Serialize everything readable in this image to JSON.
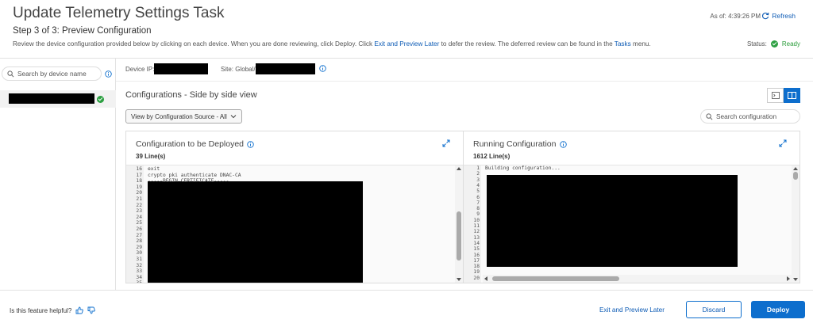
{
  "header": {
    "title": "Update Telemetry Settings Task",
    "step": "Step 3 of 3: Preview Configuration",
    "desc_part1": "Review the device configuration provided below by clicking on each device. When you are done reviewing, click Deploy. Click ",
    "desc_link1": "Exit and Preview Later",
    "desc_part2": " to defer the review. The deferred review can be found in the ",
    "desc_link2": "Tasks",
    "desc_part3": " menu.",
    "as_of": "As of: 4:39:26 PM",
    "refresh_label": "Refresh",
    "status_label": "Status:",
    "status_value": "Ready"
  },
  "sidebar": {
    "search_placeholder": "Search by device name"
  },
  "device_info": {
    "device_ip_label": "Device IP:",
    "site_label": "Site:",
    "site_prefix": "Global/"
  },
  "configs": {
    "title": "Configurations - Side by side view",
    "view_by_label": "View by Configuration Source - All",
    "search_placeholder": "Search configuration"
  },
  "left_pane": {
    "title": "Configuration to be Deployed",
    "lines": "39 Line(s)",
    "line_numbers": [
      "16",
      "17",
      "18",
      "19",
      "20",
      "21",
      "22",
      "23",
      "24",
      "25",
      "26",
      "27",
      "28",
      "29",
      "30",
      "31",
      "32",
      "33",
      "34",
      "35"
    ],
    "code_lines": [
      "exit",
      "crypto pki authenticate DNAC-CA",
      "-----BEGIN CERTIFICATE-----"
    ]
  },
  "right_pane": {
    "title": "Running Configuration",
    "lines": "1612 Line(s)",
    "line_numbers": [
      "1",
      "2",
      "3",
      "4",
      "5",
      "6",
      "7",
      "8",
      "9",
      "10",
      "11",
      "12",
      "13",
      "14",
      "15",
      "16",
      "17",
      "18",
      "19",
      "20"
    ],
    "code_lines": [
      "Building configuration..."
    ]
  },
  "footer": {
    "helpful": "Is this feature helpful?",
    "exit_later": "Exit and Preview Later",
    "discard": "Discard",
    "deploy": "Deploy"
  }
}
